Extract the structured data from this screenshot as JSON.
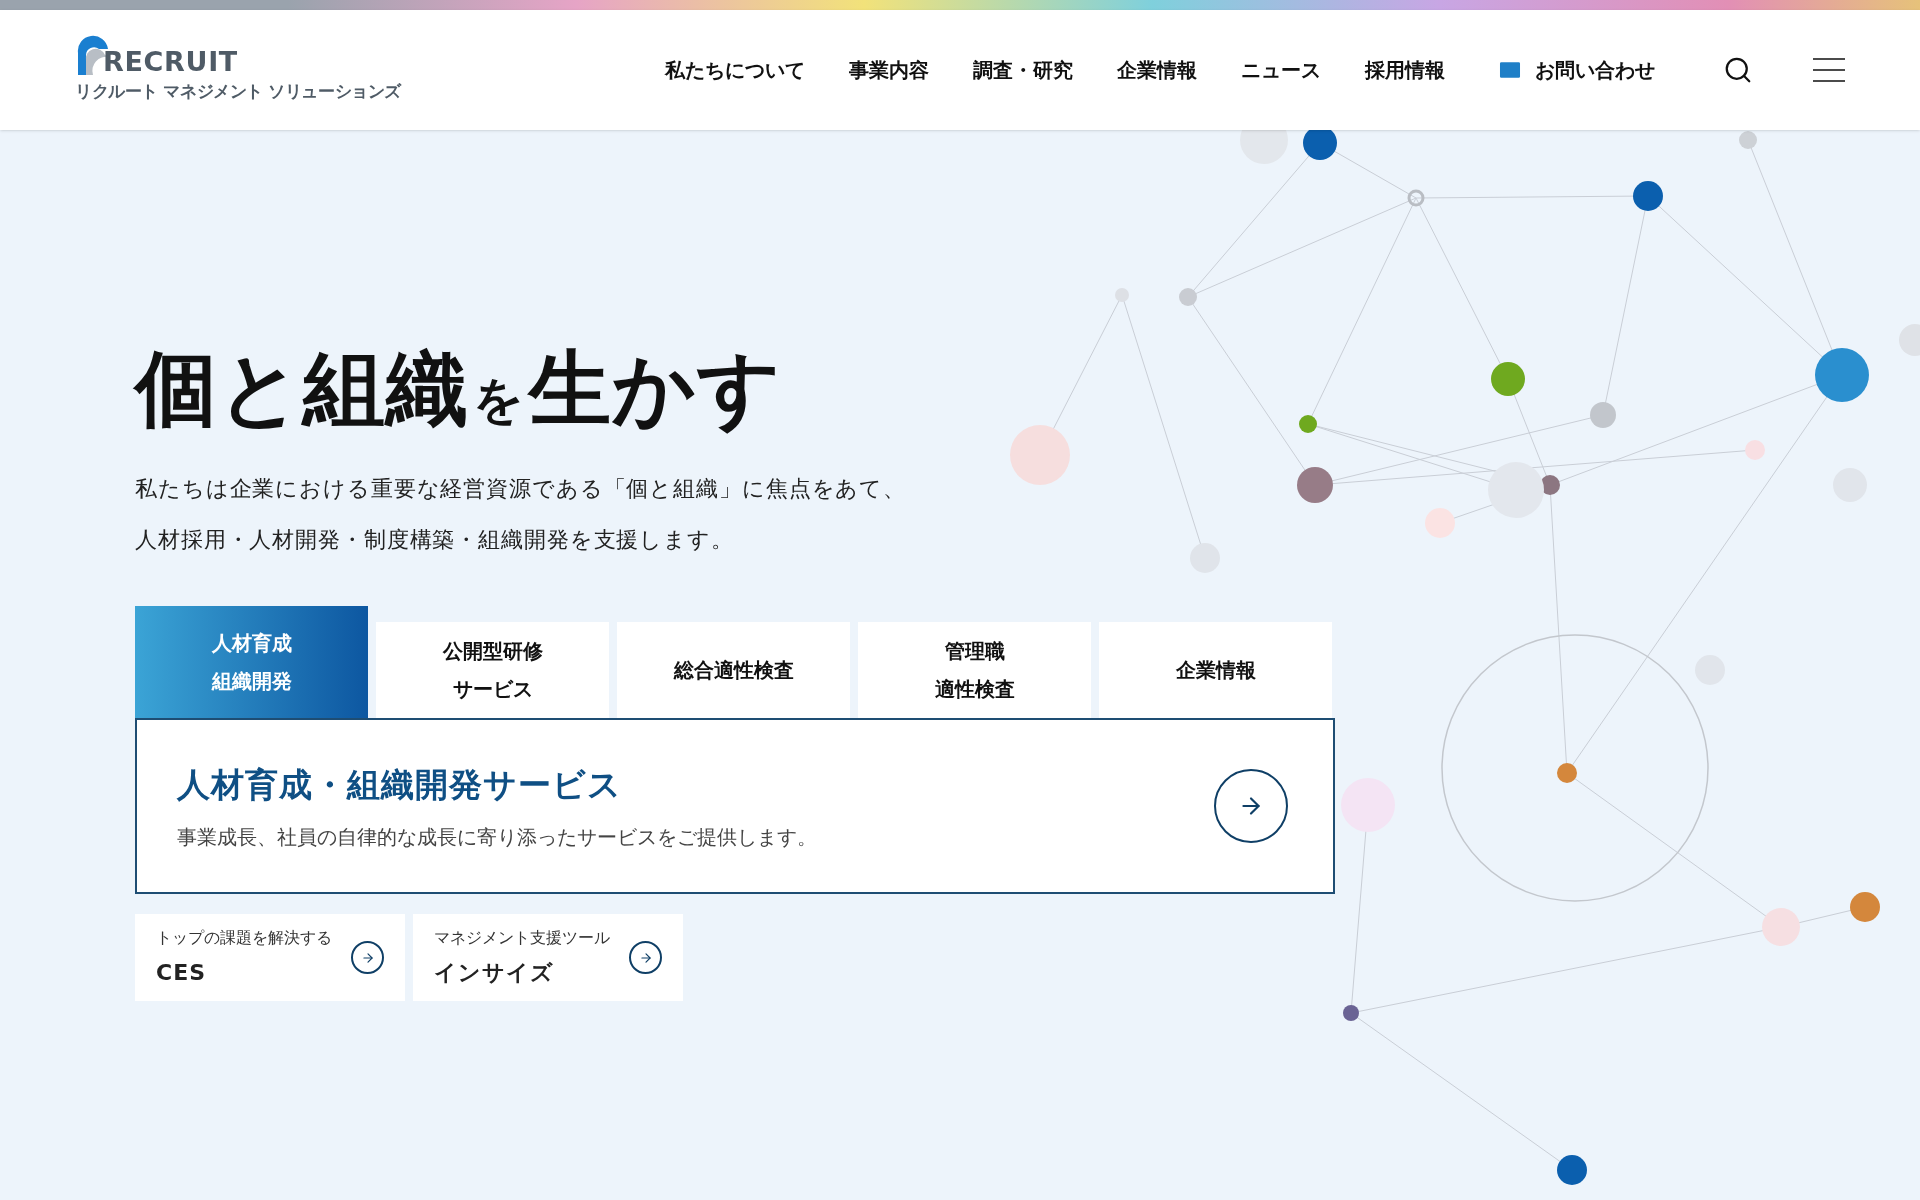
{
  "header": {
    "logo": {
      "wordmark": "RECRUIT",
      "subtitle": "リクルート マネジメント ソリューションズ"
    },
    "nav": [
      {
        "label": "私たちについて",
        "kind": "link"
      },
      {
        "label": "事業内容",
        "kind": "link"
      },
      {
        "label": "調査・研究",
        "kind": "link"
      },
      {
        "label": "企業情報",
        "kind": "link"
      },
      {
        "label": "ニュース",
        "kind": "link"
      },
      {
        "label": "採用情報",
        "kind": "link"
      },
      {
        "label": "お問い合わせ",
        "kind": "contact"
      }
    ]
  },
  "hero": {
    "title_parts": [
      {
        "text": "個と組織",
        "kind": "main"
      },
      {
        "text": "を",
        "kind": "particle"
      },
      {
        "text": "生かす",
        "kind": "main"
      }
    ],
    "lead": [
      "私たちは企業における重要な経営資源である「個と組織」に焦点をあて、",
      "人材採用・人材開発・制度構築・組織開発を支援します。"
    ]
  },
  "tabs": [
    {
      "lines": [
        "人材育成",
        "組織開発"
      ],
      "selected": true
    },
    {
      "lines": [
        "公開型研修",
        "サービス"
      ],
      "selected": false
    },
    {
      "lines": [
        "総合適性検査"
      ],
      "selected": false
    },
    {
      "lines": [
        "管理職",
        "適性検査"
      ],
      "selected": false
    },
    {
      "lines": [
        "企業情報"
      ],
      "selected": false
    }
  ],
  "panel": {
    "title": "人材育成・組織開発サービス",
    "description": "事業成長、社員の自律的な成長に寄り添ったサービスをご提供します。"
  },
  "cards": [
    {
      "caption": "トップの課題を解決する",
      "name": "CES"
    },
    {
      "caption": "マネジメント支援ツール",
      "name": "インサイズ"
    }
  ]
}
